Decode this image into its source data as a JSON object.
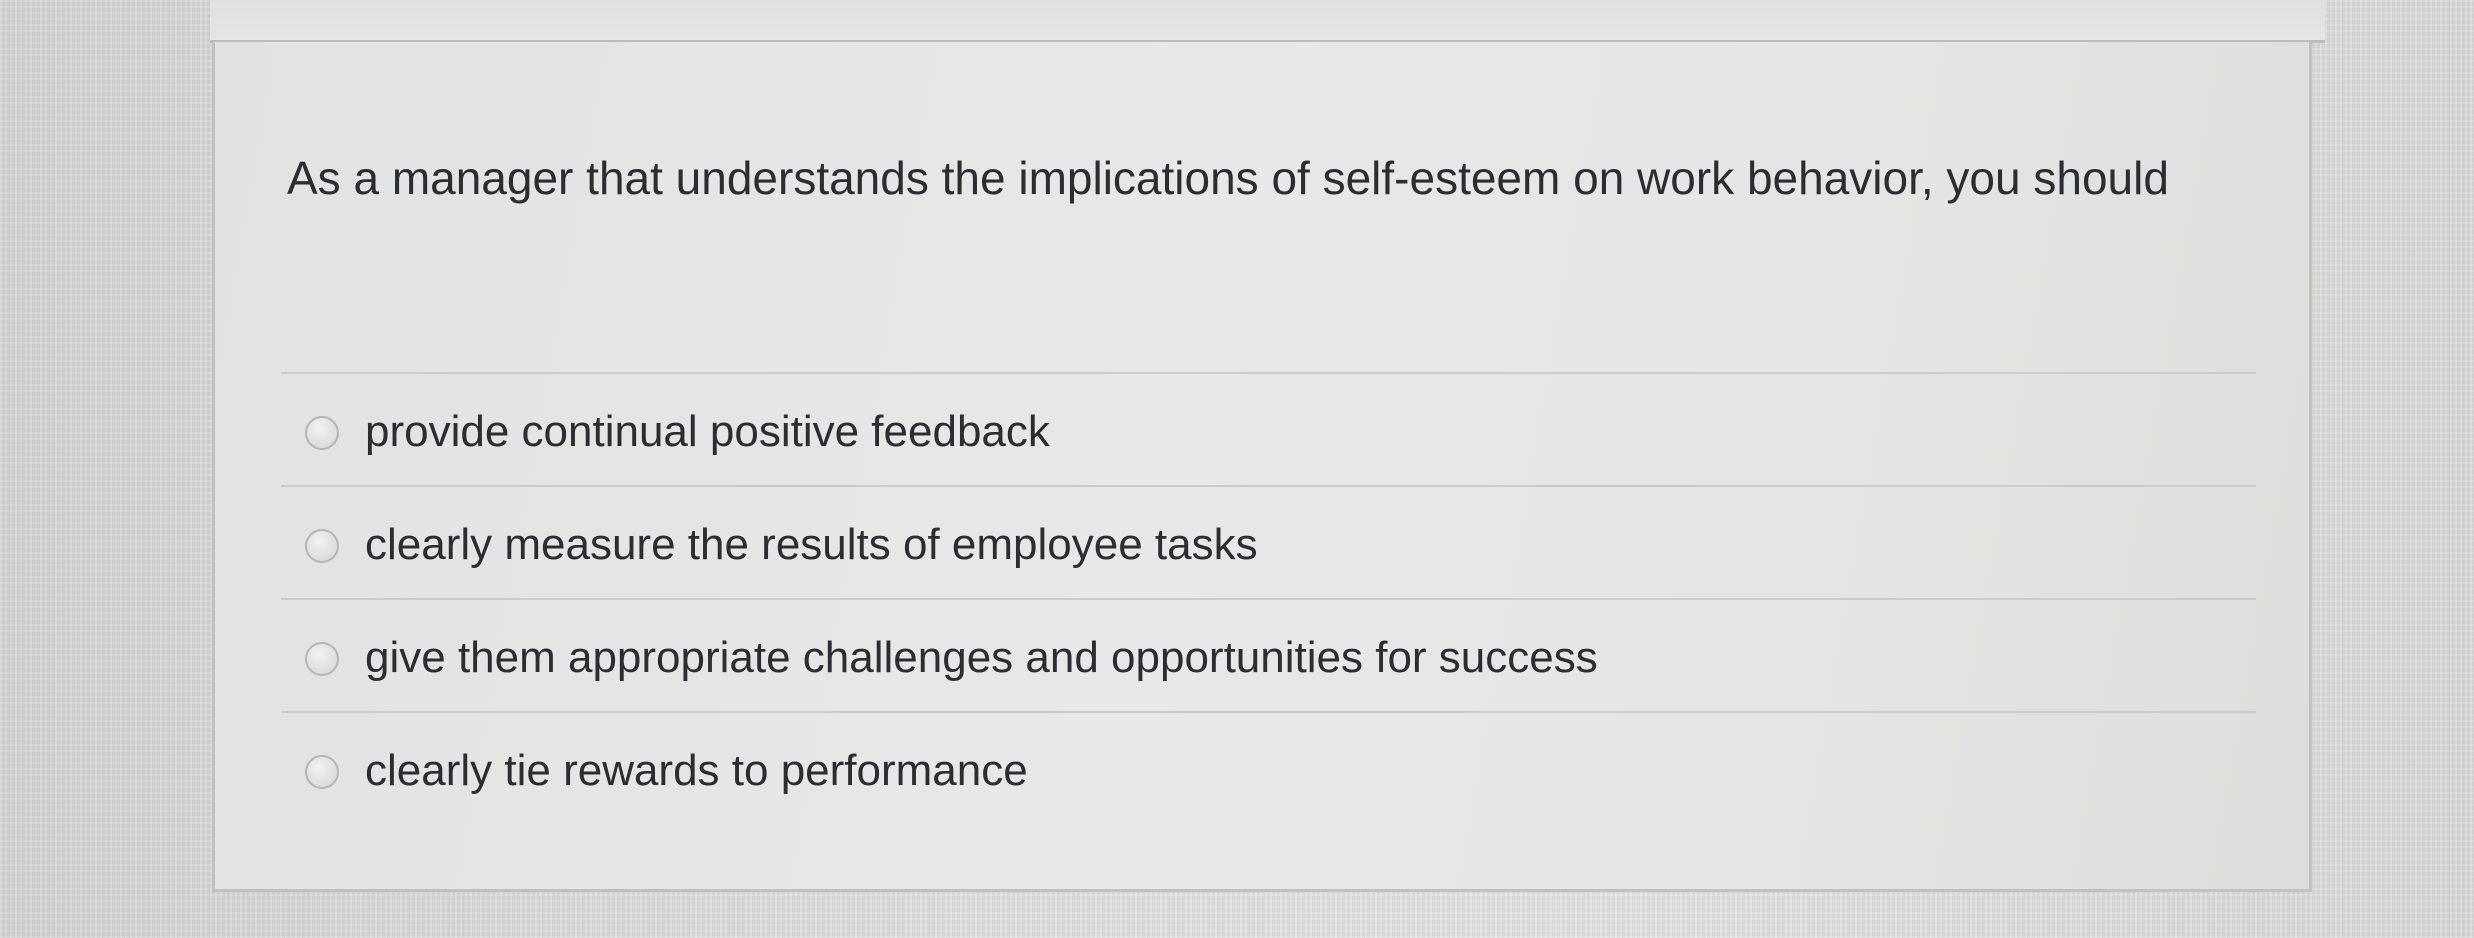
{
  "question": {
    "text": "As a manager that understands the implications of self-esteem on work behavior, you should"
  },
  "options": [
    {
      "label": "provide continual positive feedback",
      "selected": false
    },
    {
      "label": "clearly measure the results of employee tasks",
      "selected": false
    },
    {
      "label": "give them appropriate challenges and opportunities for success",
      "selected": false
    },
    {
      "label": "clearly tie rewards to performance",
      "selected": false
    }
  ],
  "colors": {
    "text": "#2d2d31",
    "card_background": "#e6e8e7",
    "divider": "#c9cccb",
    "border": "#bfc2c1"
  }
}
